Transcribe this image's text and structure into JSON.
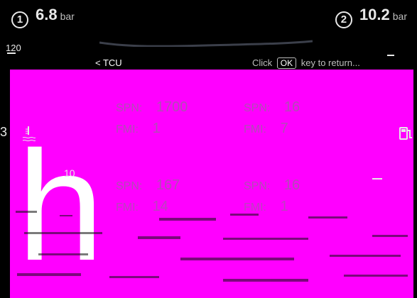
{
  "gauges": [
    {
      "index": "1",
      "value": "6.8",
      "unit": "bar"
    },
    {
      "index": "2",
      "value": "10.2",
      "unit": "bar"
    }
  ],
  "scale": {
    "top_label": "120",
    "mid_label": "10"
  },
  "nav": {
    "back_label": "< TCU",
    "hint_prefix": "Click",
    "hint_key": "OK",
    "hint_suffix": "key to return..."
  },
  "faults": [
    {
      "spn_label": "SPN:",
      "spn": "1700",
      "fmi_label": "FMI:",
      "fmi": "1"
    },
    {
      "spn_label": "SPN:",
      "spn": "16",
      "fmi_label": "FMI:",
      "fmi": "7"
    },
    {
      "spn_label": "SPN:",
      "spn": "167",
      "fmi_label": "FMI:",
      "fmi": "14"
    },
    {
      "spn_label": "SPN:",
      "spn": "16",
      "fmi_label": "FMI:",
      "fmi": "1"
    }
  ],
  "overlay": {
    "letter": "h"
  },
  "icons": {
    "temp": "coolant-temperature-icon",
    "fuel": "fuel-pump-icon"
  },
  "colors": {
    "magenta": "#ff00ff",
    "text_dim": "#b24bb6"
  }
}
